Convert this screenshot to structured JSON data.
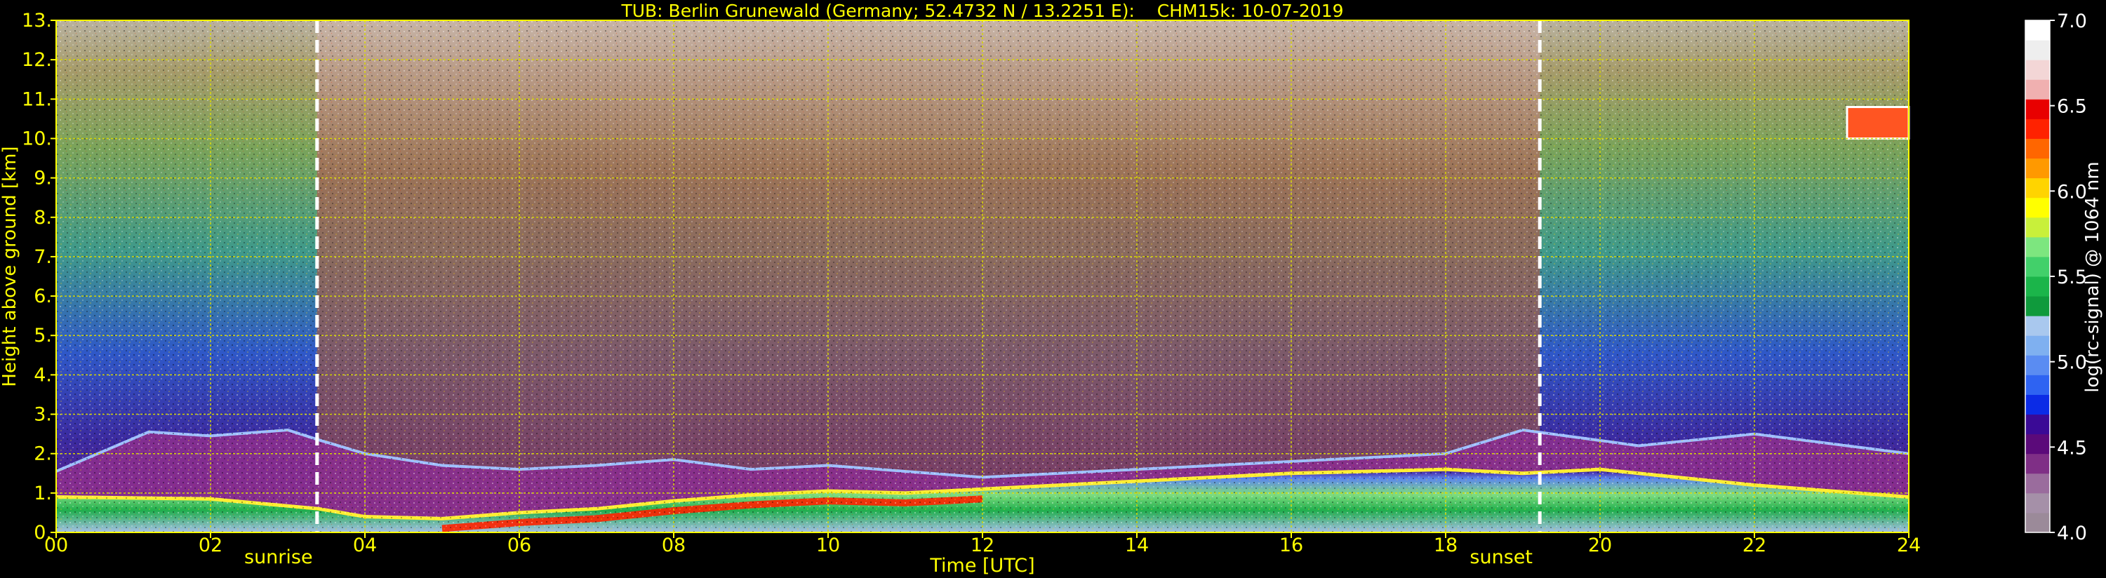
{
  "chart_data": {
    "type": "heatmap",
    "title": "TUB: Berlin Grunewald (Germany; 52.4732 N / 13.2251 E):    CHM15k: 10-07-2019",
    "xlabel": "Time [UTC]",
    "ylabel": "Height above ground [km]",
    "xlim": [
      0,
      24
    ],
    "ylim": [
      0,
      13
    ],
    "x_ticks": [
      "00",
      "02",
      "04",
      "06",
      "08",
      "10",
      "12",
      "14",
      "16",
      "18",
      "20",
      "22",
      "24"
    ],
    "y_ticks": [
      "0.",
      "1.",
      "2.",
      "3.",
      "4.",
      "5.",
      "6.",
      "7.",
      "8.",
      "9.",
      "10.",
      "11.",
      "12.",
      "13."
    ],
    "grid": true,
    "markers": [
      {
        "label": "sunrise",
        "x": 3.38
      },
      {
        "label": "sunset",
        "x": 19.22
      }
    ],
    "colorbar": {
      "label": "log(rc-signal) @ 1064 nm",
      "range": [
        4.0,
        7.0
      ],
      "ticks": [
        "4.0",
        "4.5",
        "5.0",
        "5.5",
        "6.0",
        "6.5",
        "7.0"
      ],
      "colors": [
        "#9b8a99",
        "#a590a8",
        "#9a6c9d",
        "#7f2f86",
        "#5b0a7a",
        "#3a0a96",
        "#0b2be6",
        "#2e63f2",
        "#5a8cf2",
        "#7fb0f0",
        "#a9c8ee",
        "#0f9a3c",
        "#1bb54a",
        "#42d06a",
        "#7de67f",
        "#c8f03a",
        "#ffff00",
        "#ffd400",
        "#ff9900",
        "#ff6600",
        "#ff2200",
        "#e80000",
        "#f0b0b0",
        "#f3d6d6",
        "#eeeeee",
        "#ffffff"
      ]
    },
    "layers": [
      {
        "name": "aerosol-layer-top",
        "t": [
          0,
          1.2,
          2.0,
          3.0,
          3.4,
          4.0,
          5.0,
          6.0,
          7.0,
          8.0,
          9.0,
          10.0,
          11.0,
          12.0,
          14.0,
          16.0,
          18.0,
          19.0,
          20.5,
          22.0,
          24.0
        ],
        "h": [
          1.55,
          2.55,
          2.45,
          2.6,
          2.35,
          2.0,
          1.7,
          1.6,
          1.7,
          1.85,
          1.6,
          1.7,
          1.55,
          1.4,
          1.6,
          1.8,
          2.0,
          2.6,
          2.2,
          2.5,
          2.0
        ]
      },
      {
        "name": "boundary-layer-top",
        "t": [
          0,
          2.0,
          3.4,
          4.0,
          5.0,
          6.0,
          7.0,
          8.0,
          9.0,
          10.0,
          11.0,
          12.0,
          14.0,
          16.0,
          18.0,
          19.0,
          20.0,
          22.0,
          24.0
        ],
        "h": [
          0.9,
          0.85,
          0.6,
          0.4,
          0.35,
          0.5,
          0.6,
          0.8,
          0.95,
          1.05,
          1.0,
          1.1,
          1.3,
          1.5,
          1.6,
          1.5,
          1.6,
          1.2,
          0.9
        ]
      }
    ],
    "cloud_patches": [
      {
        "t0": 23.2,
        "t1": 24.0,
        "h0": 10.0,
        "h1": 10.8
      }
    ]
  }
}
